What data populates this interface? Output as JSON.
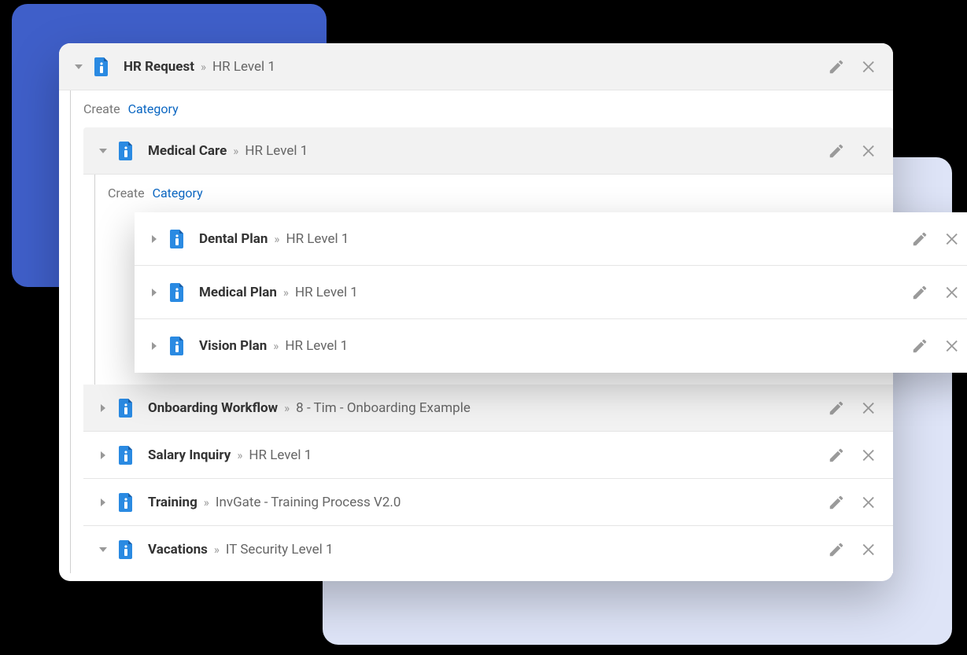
{
  "colors": {
    "accent_blue": "#3f5fc9",
    "accent_light": "#dee4f7",
    "doc_icon_blue": "#2a8ae2",
    "doc_icon_dark": "#1a5fa8"
  },
  "create": {
    "prefix": "Create",
    "link": "Category"
  },
  "root": {
    "title": "HR Request",
    "subtitle": "HR Level 1",
    "expanded": true
  },
  "medical": {
    "title": "Medical Care",
    "subtitle": "HR Level 1",
    "expanded": true,
    "children": [
      {
        "title": "Dental Plan",
        "subtitle": "HR Level 1"
      },
      {
        "title": "Medical Plan",
        "subtitle": "HR Level 1"
      },
      {
        "title": "Vision Plan",
        "subtitle": "HR Level 1"
      }
    ]
  },
  "siblings": [
    {
      "title": "Onboarding Workflow",
      "subtitle": "8 - Tim - Onboarding Example",
      "expanded": false
    },
    {
      "title": "Salary Inquiry",
      "subtitle": "HR Level 1",
      "expanded": false
    },
    {
      "title": "Training",
      "subtitle": "InvGate - Training Process V2.0",
      "expanded": false
    },
    {
      "title": "Vacations",
      "subtitle": "IT Security Level 1",
      "expanded": true
    }
  ]
}
